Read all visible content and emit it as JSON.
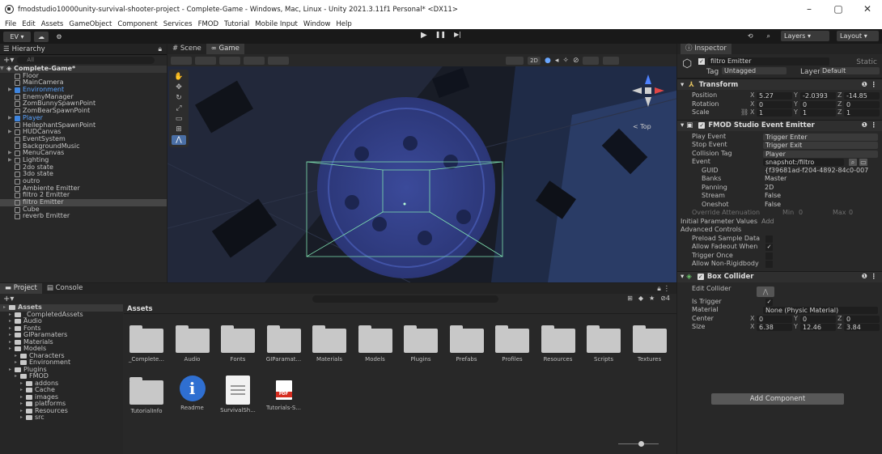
{
  "window": {
    "title": "fmodstudio10000unity-survival-shooter-project - Complete-Game - Windows, Mac, Linux - Unity 2021.3.11f1 Personal* <DX11>",
    "controls": [
      "–",
      "▢",
      "✕"
    ]
  },
  "menu": [
    "File",
    "Edit",
    "Assets",
    "GameObject",
    "Component",
    "Services",
    "FMOD",
    "Tutorial",
    "Mobile Input",
    "Window",
    "Help"
  ],
  "toolbar": {
    "account": "EV ▾",
    "play_icons": [
      "▶",
      "❚❚",
      "▶|"
    ],
    "layers": "Layers",
    "layout": "Layout"
  },
  "hierarchy": {
    "title": "Hierarchy",
    "search_placeholder": "All",
    "scene": "Complete-Game*",
    "items": [
      {
        "label": "Floor",
        "indent": 1,
        "style": ""
      },
      {
        "label": "MainCamera",
        "indent": 1,
        "style": ""
      },
      {
        "label": "Environment",
        "indent": 1,
        "style": "blue",
        "arrow": true
      },
      {
        "label": "EnemyManager",
        "indent": 1,
        "style": ""
      },
      {
        "label": "ZomBunnySpawnPoint",
        "indent": 1,
        "style": ""
      },
      {
        "label": "ZomBearSpawnPoint",
        "indent": 1,
        "style": ""
      },
      {
        "label": "Player",
        "indent": 1,
        "style": "blue",
        "arrow": true
      },
      {
        "label": "HellephantSpawnPoint",
        "indent": 1,
        "style": ""
      },
      {
        "label": "HUDCanvas",
        "indent": 1,
        "style": "",
        "arrow": true
      },
      {
        "label": "EventSystem",
        "indent": 1,
        "style": ""
      },
      {
        "label": "BackgroundMusic",
        "indent": 1,
        "style": ""
      },
      {
        "label": "MenuCanvas",
        "indent": 1,
        "style": "",
        "arrow": true
      },
      {
        "label": "Lighting",
        "indent": 1,
        "style": "",
        "arrow": true
      },
      {
        "label": "2do state",
        "indent": 1,
        "style": ""
      },
      {
        "label": "3do state",
        "indent": 1,
        "style": ""
      },
      {
        "label": "outro",
        "indent": 1,
        "style": ""
      },
      {
        "label": "Ambiente Emitter",
        "indent": 1,
        "style": ""
      },
      {
        "label": "filtro 2 Emitter",
        "indent": 1,
        "style": ""
      },
      {
        "label": "filtro Emitter",
        "indent": 1,
        "style": "selected"
      },
      {
        "label": "Cube",
        "indent": 1,
        "style": ""
      },
      {
        "label": "reverb Emitter",
        "indent": 1,
        "style": ""
      }
    ]
  },
  "scene": {
    "tabs": [
      "Scene",
      "Game"
    ],
    "mode_2d": "2D",
    "gizmo_label": "< Top"
  },
  "project": {
    "tabs": [
      "Project",
      "Console"
    ],
    "tree": [
      {
        "label": "Assets",
        "level": 0,
        "head": true
      },
      {
        "label": "_CompletedAssets",
        "level": 1
      },
      {
        "label": "Audio",
        "level": 1
      },
      {
        "label": "Fonts",
        "level": 1
      },
      {
        "label": "GIParamaters",
        "level": 1
      },
      {
        "label": "Materials",
        "level": 1
      },
      {
        "label": "Models",
        "level": 1
      },
      {
        "label": "Characters",
        "level": 2
      },
      {
        "label": "Environment",
        "level": 2
      },
      {
        "label": "Plugins",
        "level": 1
      },
      {
        "label": "FMOD",
        "level": 2
      },
      {
        "label": "addons",
        "level": 3
      },
      {
        "label": "Cache",
        "level": 3
      },
      {
        "label": "images",
        "level": 3
      },
      {
        "label": "platforms",
        "level": 3
      },
      {
        "label": "Resources",
        "level": 3
      },
      {
        "label": "src",
        "level": 3
      }
    ],
    "breadcrumb": "Assets",
    "assets_row1": [
      "_Complete...",
      "Audio",
      "Fonts",
      "GIParamat...",
      "Materials",
      "Models",
      "Plugins",
      "Prefabs",
      "Profiles",
      "Resources",
      "Scripts",
      "Textures"
    ],
    "assets_row2": [
      {
        "label": "TutorialInfo",
        "kind": "folder"
      },
      {
        "label": "Readme",
        "kind": "info"
      },
      {
        "label": "SurvivalSh...",
        "kind": "doc"
      },
      {
        "label": "Tutorials-S...",
        "kind": "pdf"
      }
    ],
    "count_badge": "4"
  },
  "inspector": {
    "title": "Inspector",
    "object_name": "filtro Emitter",
    "static": "Static",
    "tag_label": "Tag",
    "tag_value": "Untagged",
    "layer_label": "Layer",
    "layer_value": "Default",
    "transform": {
      "title": "Transform",
      "position": {
        "label": "Position",
        "x": "5.27",
        "y": "-2.0393",
        "z": "-14.85"
      },
      "rotation": {
        "label": "Rotation",
        "x": "0",
        "y": "0",
        "z": "0"
      },
      "scale": {
        "label": "Scale",
        "x": "1",
        "y": "1",
        "z": "1"
      }
    },
    "fmod": {
      "title": "FMOD Studio Event Emitter",
      "play_event_label": "Play Event",
      "play_event": "Trigger Enter",
      "stop_event_label": "Stop Event",
      "stop_event": "Trigger Exit",
      "collision_tag_label": "Collision Tag",
      "collision_tag": "Player",
      "event_label": "Event",
      "event": "snapshot:/filtro",
      "guid_label": "GUID",
      "guid": "{f39681ad-f204-4892-84c0-007",
      "banks_label": "Banks",
      "banks": "Master",
      "panning_label": "Panning",
      "panning": "2D",
      "stream_label": "Stream",
      "stream": "False",
      "oneshot_label": "Oneshot",
      "oneshot": "False",
      "override_label": "Override Attenuation",
      "min_label": "Min",
      "min": "0",
      "max_label": "Max",
      "max": "0",
      "initial_params": "Initial Parameter Values",
      "add_label": "Add",
      "advanced": "Advanced Controls",
      "preload": "Preload Sample Data",
      "fadeout": "Allow Fadeout When",
      "trigger_once": "Trigger Once",
      "non_rigid": "Allow Non-Rigidbody"
    },
    "box": {
      "title": "Box Collider",
      "edit_label": "Edit Collider",
      "is_trigger": "Is Trigger",
      "material_label": "Material",
      "material": "None (Physic Material)",
      "center": {
        "label": "Center",
        "x": "0",
        "y": "0",
        "z": "0"
      },
      "size": {
        "label": "Size",
        "x": "6.38",
        "y": "12.46",
        "z": "3.84"
      }
    },
    "add_component": "Add Component"
  }
}
